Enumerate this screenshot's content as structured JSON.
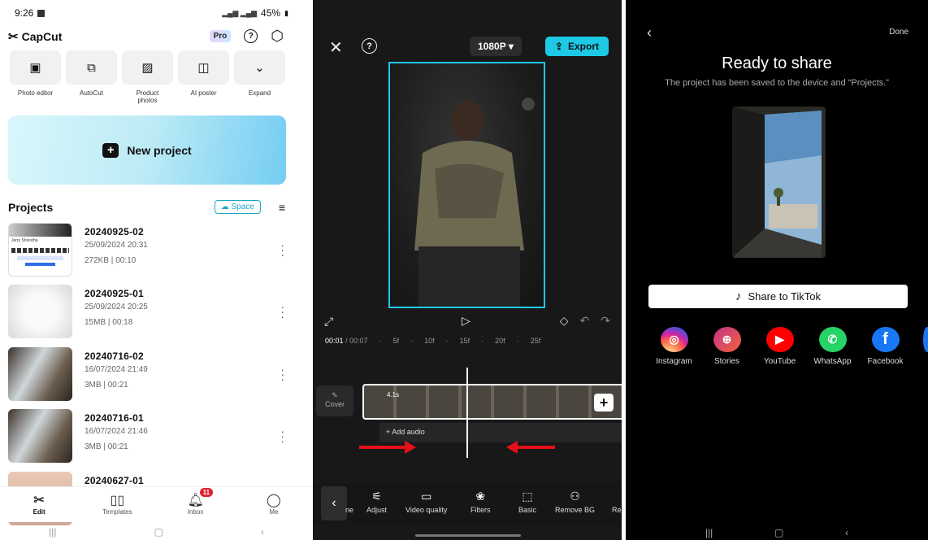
{
  "screen1": {
    "status": {
      "time": "9:26",
      "battery": "45%"
    },
    "brand": "CapCut",
    "pro_label": "Pro",
    "tools": [
      {
        "label": "Photo editor",
        "icon": "photo-editor-icon"
      },
      {
        "label": "AutoCut",
        "icon": "autocut-icon"
      },
      {
        "label": "Product photos",
        "icon": "product-photos-icon"
      },
      {
        "label": "AI poster",
        "icon": "ai-poster-icon"
      },
      {
        "label": "Expand",
        "icon": "chevron-down-icon"
      }
    ],
    "new_project": "New project",
    "projects_title": "Projects",
    "space_label": "Space",
    "projects": [
      {
        "name": "20240925-02",
        "date": "25/09/2024 20:31",
        "size": "272KB",
        "duration": "00:10"
      },
      {
        "name": "20240925-01",
        "date": "25/09/2024 20:25",
        "size": "15MB",
        "duration": "00:18"
      },
      {
        "name": "20240716-02",
        "date": "16/07/2024 21:49",
        "size": "3MB",
        "duration": "00:21"
      },
      {
        "name": "20240716-01",
        "date": "16/07/2024 21:46",
        "size": "3MB",
        "duration": "00:21"
      },
      {
        "name": "20240627-01",
        "date": "",
        "size": "",
        "duration": ""
      }
    ],
    "nav": [
      {
        "label": "Edit"
      },
      {
        "label": "Templates"
      },
      {
        "label": "Inbox",
        "badge": "11"
      },
      {
        "label": "Me"
      }
    ]
  },
  "screen2": {
    "resolution": "1080P",
    "export_label": "Export",
    "timecode_current": "00:01",
    "timecode_total": "/ 00:07",
    "ticks": [
      "5f",
      "10f",
      "15f",
      "20f",
      "25f"
    ],
    "cover_label": "Cover",
    "clip_length": "4.1s",
    "add_audio": "+ Add audio",
    "toolbar": [
      "Adjust",
      "Video quality",
      "Filters",
      "Basic",
      "Remove BG"
    ],
    "toolbar_partial_left": "ne",
    "toolbar_partial_right": "Re"
  },
  "screen3": {
    "done": "Done",
    "title": "Ready to share",
    "subtitle": "The project has been saved to the device and “Projects.”",
    "tiktok_button": "Share to TikTok",
    "apps": [
      {
        "label": "Instagram",
        "color": "#d62976"
      },
      {
        "label": "Stories",
        "color": "#e02c8a"
      },
      {
        "label": "YouTube",
        "color": "#ff0000"
      },
      {
        "label": "WhatsApp",
        "color": "#25d366"
      },
      {
        "label": "Facebook",
        "color": "#1877f2"
      }
    ]
  }
}
